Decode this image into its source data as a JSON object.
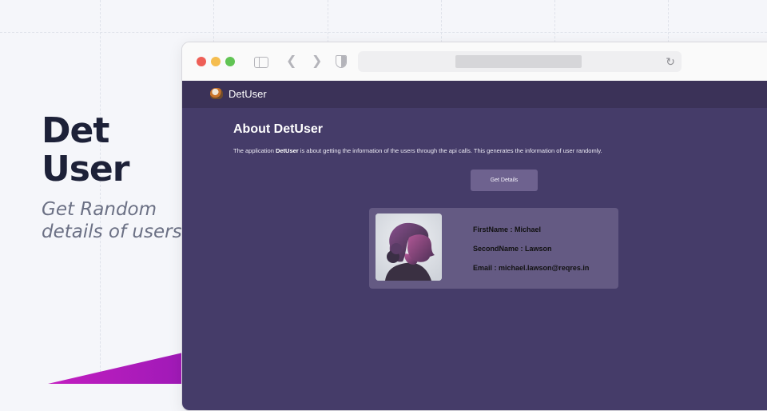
{
  "hero": {
    "title_line1": "Det",
    "title_line2": "User",
    "subtitle_line1": "Get Random",
    "subtitle_line2": "details of users"
  },
  "browser": {
    "icons": [
      "sidebar-toggle-icon",
      "back-icon",
      "forward-icon",
      "shield-icon",
      "reload-icon"
    ]
  },
  "app": {
    "brand": "DetUser",
    "about_title": "About DetUser",
    "about_text_prefix": "The application ",
    "about_text_brand": "DetUser",
    "about_text_suffix": " is about getting the information of the users through the api calls. This generates the information of user randomly.",
    "button_label": "Get Details",
    "user": {
      "first_name_line": "FirstName : Michael",
      "second_name_line": "SecondName : Lawson",
      "email_line": "Email : michael.lawson@reqres.in"
    }
  },
  "colors": {
    "app_bg": "#453c69",
    "navbar_bg": "#3b3258",
    "card_bg": "#645a83",
    "button_bg": "#6e628f",
    "accent_wedge": "#c21ec0",
    "hero_text": "#1d2138"
  }
}
